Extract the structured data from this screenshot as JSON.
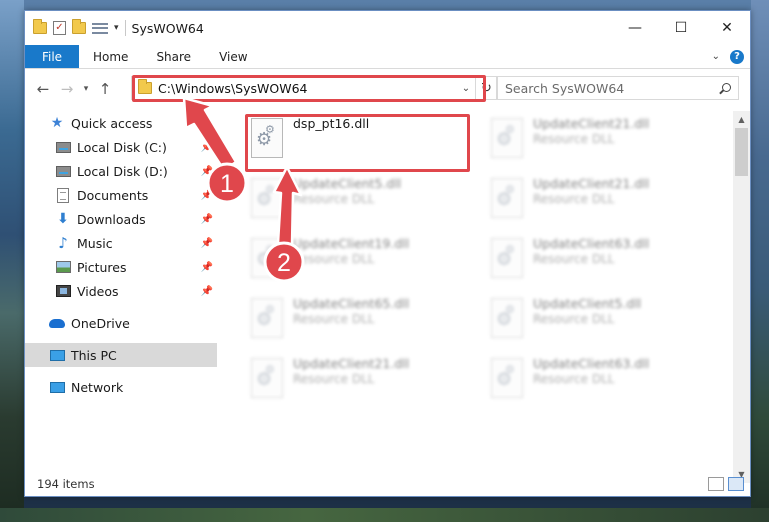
{
  "window": {
    "title": "SysWOW64",
    "controls": {
      "minimize": "—",
      "maximize": "☐",
      "close": "✕"
    }
  },
  "ribbon": {
    "tabs": [
      "File",
      "Home",
      "Share",
      "View"
    ],
    "help": "?"
  },
  "address": {
    "path": "C:\\Windows\\SysWOW64",
    "search_placeholder": "Search SysWOW64"
  },
  "nav": {
    "quick_access": "Quick access",
    "items": [
      {
        "label": "Local Disk (C:)",
        "icon": "disk-icon",
        "pinned": true
      },
      {
        "label": "Local Disk (D:)",
        "icon": "disk-icon",
        "pinned": true
      },
      {
        "label": "Documents",
        "icon": "documents-icon",
        "pinned": true
      },
      {
        "label": "Downloads",
        "icon": "downloads-icon",
        "pinned": true
      },
      {
        "label": "Music",
        "icon": "music-icon",
        "pinned": true
      },
      {
        "label": "Pictures",
        "icon": "pictures-icon",
        "pinned": true
      },
      {
        "label": "Videos",
        "icon": "videos-icon",
        "pinned": true
      }
    ],
    "onedrive": "OneDrive",
    "this_pc": "This PC",
    "network": "Network"
  },
  "files": [
    {
      "name": "dsp_pt16.dll",
      "type": "",
      "highlighted": true
    },
    {
      "name": "UpdateClient21.dll",
      "type": "Resource DLL"
    },
    {
      "name": "UpdateClient5.dll",
      "type": "Resource DLL"
    },
    {
      "name": "UpdateClient21.dll",
      "type": "Resource DLL"
    },
    {
      "name": "UpdateClient19.dll",
      "type": "Resource DLL"
    },
    {
      "name": "UpdateClient63.dll",
      "type": "Resource DLL"
    },
    {
      "name": "UpdateClient65.dll",
      "type": "Resource DLL"
    },
    {
      "name": "UpdateClient5.dll",
      "type": "Resource DLL"
    },
    {
      "name": "UpdateClient21.dll",
      "type": "Resource DLL"
    },
    {
      "name": "UpdateClient63.dll",
      "type": "Resource DLL"
    }
  ],
  "status": {
    "item_count": "194 items"
  },
  "annotations": {
    "step1": "1",
    "step2": "2",
    "color": "#e0474c"
  }
}
